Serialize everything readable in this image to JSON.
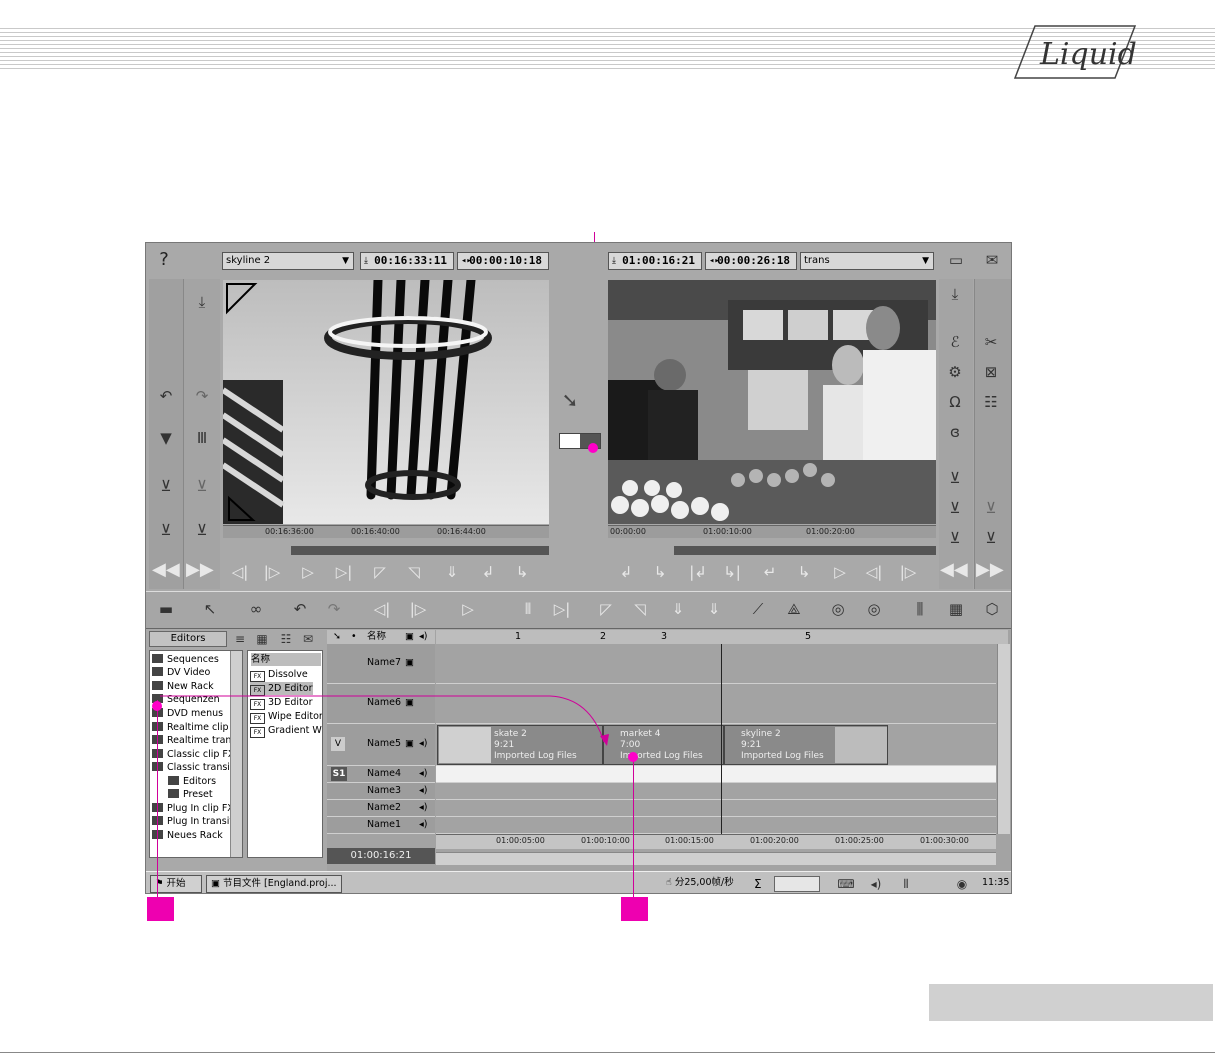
{
  "brand": "Liquid",
  "left_viewer": {
    "clip_name": "skyline 2",
    "timecode_in": "00:16:33:11",
    "duration": "00:00:10:18",
    "ruler_ticks": [
      "00:16:36:00",
      "00:16:40:00",
      "00:16:44:00"
    ]
  },
  "right_viewer": {
    "timecode_in": "01:00:16:21",
    "duration": "00:00:26:18",
    "preset": "trans",
    "ruler_ticks": [
      "00:00:00",
      "01:00:10:00",
      "01:00:20:00"
    ]
  },
  "rack": {
    "tab": "Editors",
    "items": [
      "Sequences",
      "DV Video",
      "New Rack",
      "Sequenzen",
      "DVD menus",
      "Realtime clip F",
      "Realtime transi",
      "Classic clip FX",
      "Classic transitic",
      "Editors",
      "Preset",
      "Plug In clip FX",
      "Plug In transitic",
      "Neues Rack"
    ]
  },
  "editor_list": {
    "header": "名称",
    "items": [
      "Dissolve",
      "2D Editor",
      "3D Editor",
      "Wipe Editor",
      "Gradient Wipe"
    ],
    "selected": "2D Editor"
  },
  "timeline": {
    "name_header": "名称",
    "markers": [
      "1",
      "2",
      "3",
      "5"
    ],
    "tracks": [
      "Name7",
      "Name6",
      "Name5",
      "Name4",
      "Name3",
      "Name2",
      "Name1"
    ],
    "track_v_label": "V",
    "track_s1_label": "S1",
    "clips": [
      {
        "name": "skate 2",
        "duration": "9:21",
        "source": "Imported Log Files"
      },
      {
        "name": "market 4",
        "duration": "7:00",
        "source": "Imported Log Files"
      },
      {
        "name": "skyline 2",
        "duration": "9:21",
        "source": "Imported Log Files"
      }
    ],
    "ruler_ticks": [
      "01:00:05:00",
      "01:00:10:00",
      "01:00:15:00",
      "01:00:20:00",
      "01:00:25:00",
      "01:00:30:00"
    ],
    "current_tc": "01:00:16:21"
  },
  "taskbar": {
    "start": "开始",
    "task": "节目文件 [England.proj...",
    "fps": "分25,00帧/秒",
    "sigma": "Σ",
    "clock": "11:35"
  }
}
